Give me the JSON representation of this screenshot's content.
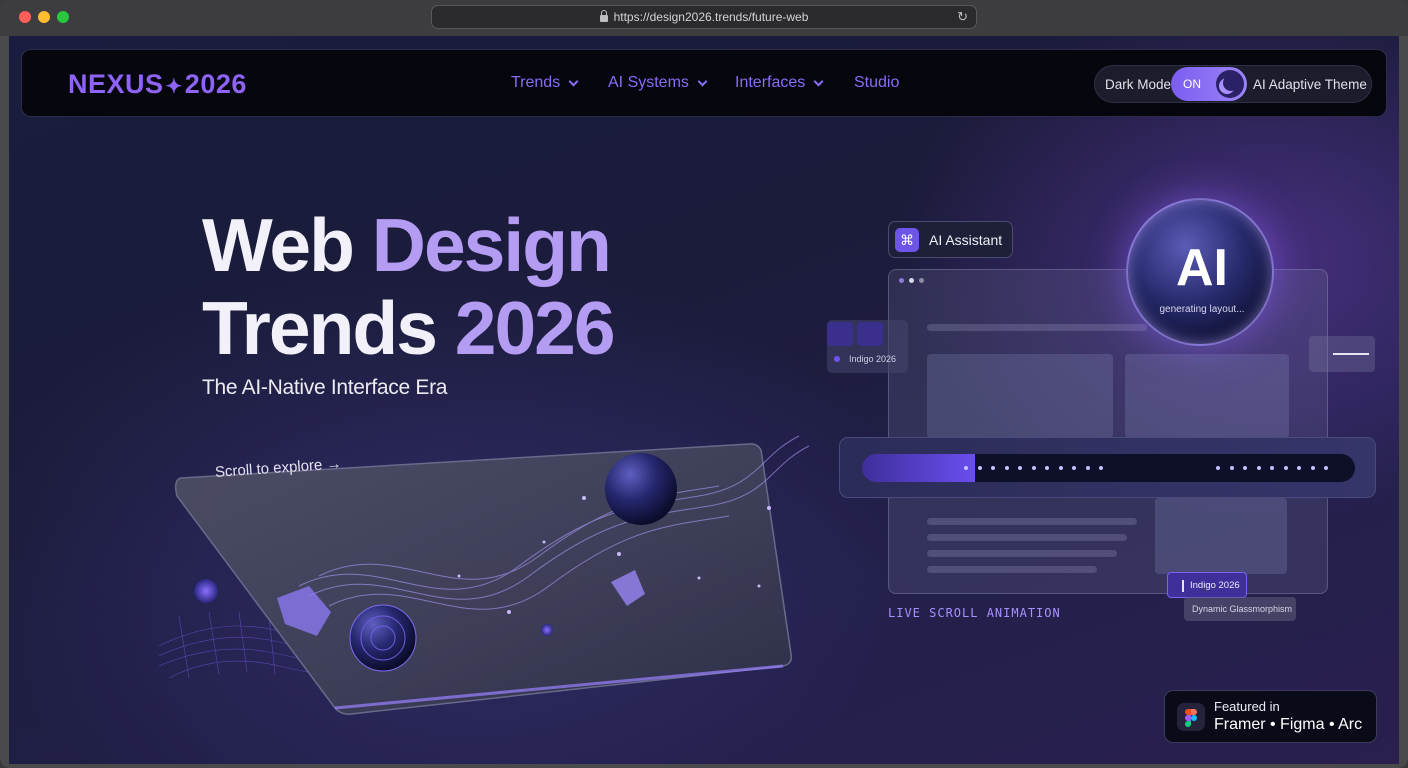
{
  "browser": {
    "url": "https://design2026.trends/future-web"
  },
  "nav": {
    "logo_left": "NEXUS",
    "logo_sep": "✦",
    "logo_right": "2026",
    "items": [
      {
        "label": "Trends"
      },
      {
        "label": "AI Systems"
      },
      {
        "label": "Interfaces"
      },
      {
        "label": "Studio"
      }
    ],
    "dark_mode_label": "Dark Mode",
    "toggle_state": "ON",
    "adaptive_label": "AI Adaptive Theme"
  },
  "hero": {
    "title_line1_a": "Web ",
    "title_line1_b": "Design",
    "title_line2_a": "Trends ",
    "title_line2_b": "2026",
    "subtitle": "The AI-Native Interface Era",
    "scroll_cta": "Scroll to explore →"
  },
  "assistant": {
    "chip_icon": "⌘",
    "chip_label": "AI Assistant",
    "orb_label": "AI",
    "orb_status": "generating layout..."
  },
  "mockup": {
    "side_chip_label": "Indigo 2026",
    "progress": 0.23,
    "live_label": "LIVE SCROLL ANIMATION",
    "tag_indigo": "Indigo 2026",
    "tag_glass": "Dynamic Glassmorphism"
  },
  "featured": {
    "prefix": "Featured in",
    "list": "Framer • Figma • Arc"
  },
  "colors": {
    "accent": "#8e63f5",
    "nav_bg": "#05060e",
    "page_bg": "#1b1b3a"
  }
}
